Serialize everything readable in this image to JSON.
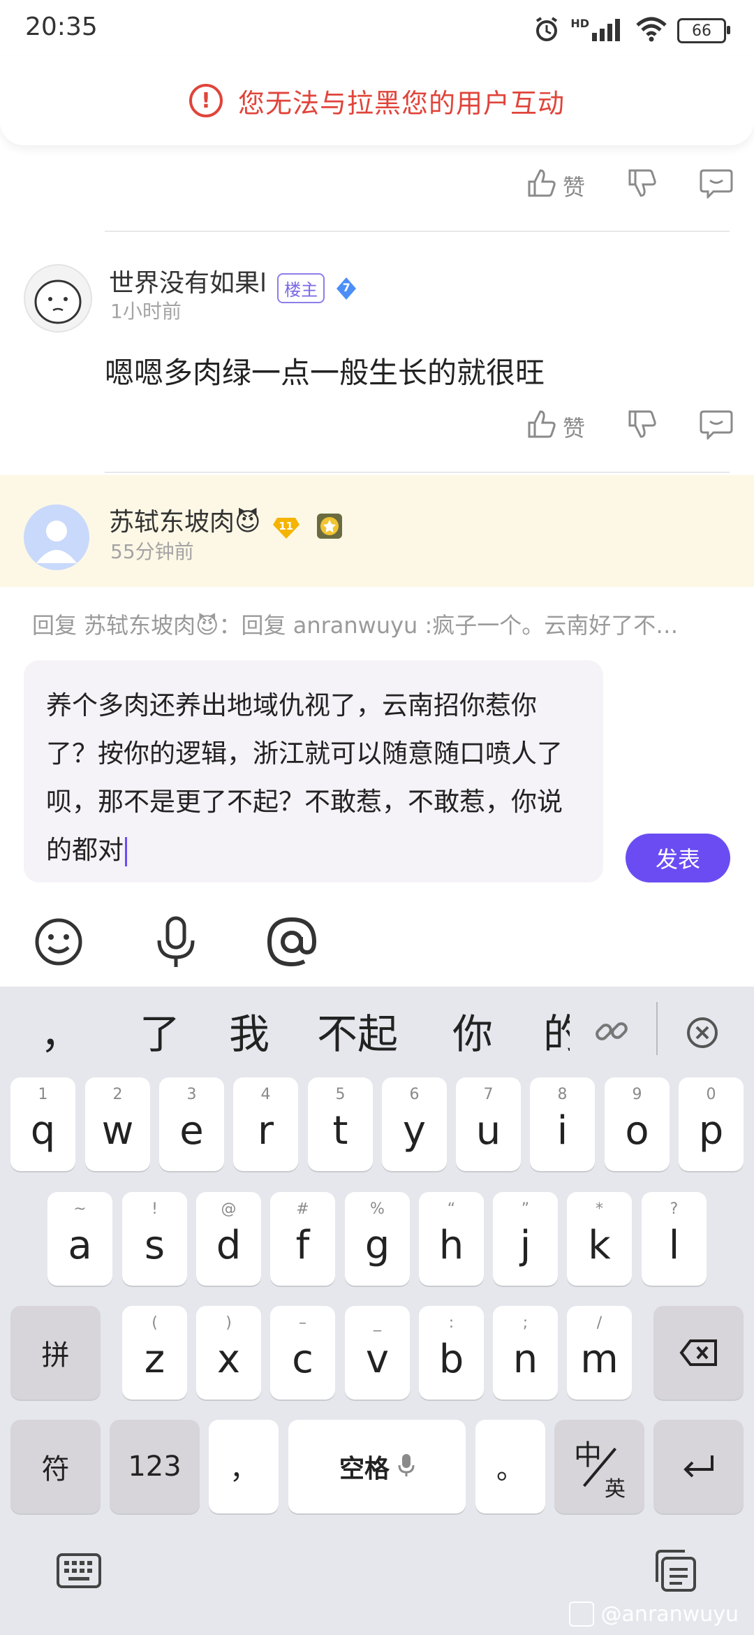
{
  "status_bar": {
    "time": "20:35",
    "battery": "66",
    "network": "HD"
  },
  "banner": {
    "text": "您无法与拉黑您的用户互动"
  },
  "actions": {
    "like": "赞"
  },
  "comment": {
    "username": "世界没有如果l",
    "host_tag": "楼主",
    "level": "7",
    "time": "1小时前",
    "content": "嗯嗯多肉绿一点一般生长的就很旺"
  },
  "reply_user": {
    "username": "苏轼东坡肉😈",
    "level": "11",
    "time": "55分钟前"
  },
  "reply_hint": "回复 苏轼东坡肉😈：回复 anranwuyu  :疯子一个。云南好了不…",
  "input": {
    "text": "养个多肉还养出地域仇视了，云南招你惹你了？按你的逻辑，浙江就可以随意随口喷人了呗，那不是更了不起？不敢惹，不敢惹，你说的都对"
  },
  "send_button": "发表",
  "candidates": [
    "，",
    "了",
    "我",
    "不起",
    "你",
    "的"
  ],
  "keyboard": {
    "row1": [
      {
        "num": "1",
        "ch": "q"
      },
      {
        "num": "2",
        "ch": "w"
      },
      {
        "num": "3",
        "ch": "e"
      },
      {
        "num": "4",
        "ch": "r"
      },
      {
        "num": "5",
        "ch": "t"
      },
      {
        "num": "6",
        "ch": "y"
      },
      {
        "num": "7",
        "ch": "u"
      },
      {
        "num": "8",
        "ch": "i"
      },
      {
        "num": "9",
        "ch": "o"
      },
      {
        "num": "0",
        "ch": "p"
      }
    ],
    "row2": [
      {
        "num": "~",
        "ch": "a"
      },
      {
        "num": "!",
        "ch": "s"
      },
      {
        "num": "@",
        "ch": "d"
      },
      {
        "num": "#",
        "ch": "f"
      },
      {
        "num": "%",
        "ch": "g"
      },
      {
        "num": "“",
        "ch": "h"
      },
      {
        "num": "”",
        "ch": "j"
      },
      {
        "num": "*",
        "ch": "k"
      },
      {
        "num": "?",
        "ch": "l"
      }
    ],
    "row3": [
      {
        "num": "(",
        "ch": "z"
      },
      {
        "num": ")",
        "ch": "x"
      },
      {
        "num": "–",
        "ch": "c"
      },
      {
        "num": "_",
        "ch": "v"
      },
      {
        "num": ":",
        "ch": "b"
      },
      {
        "num": ";",
        "ch": "n"
      },
      {
        "num": "/",
        "ch": "m"
      }
    ],
    "pinyin": "拼",
    "symbol": "符",
    "numeric": "123",
    "comma": "，",
    "space": "空格",
    "period": "。",
    "lang_zh": "中",
    "lang_en": "英"
  },
  "watermark": "@anranwuyu",
  "colors": {
    "accent": "#6b4cf3",
    "alert": "#e0443a",
    "highlight": "#fdf8e6"
  }
}
